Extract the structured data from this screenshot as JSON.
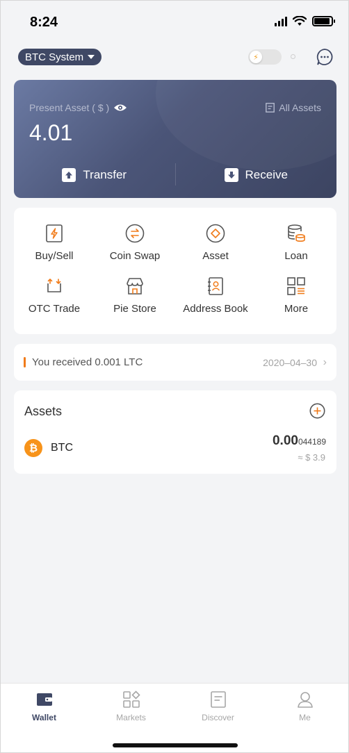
{
  "status_bar": {
    "time": "8:24",
    "battery_level": 0.9
  },
  "header": {
    "system_selector": "BTC System",
    "toggle_icon": "lightning-icon",
    "message_icon": "chat-bubble-icon"
  },
  "asset_card": {
    "label": "Present Asset ( $ )",
    "value": "4.01",
    "all_assets": "All Assets",
    "transfer": "Transfer",
    "receive": "Receive",
    "colors": {
      "gradient_start": "#6b7aa3",
      "gradient_end": "#3c4461"
    }
  },
  "menu": {
    "items": [
      {
        "label": "Buy/Sell",
        "icon": "lightning-bolt-icon"
      },
      {
        "label": "Coin Swap",
        "icon": "swap-arrows-icon"
      },
      {
        "label": "Asset",
        "icon": "diamond-icon"
      },
      {
        "label": "Loan",
        "icon": "coin-stack-icon"
      },
      {
        "label": "OTC Trade",
        "icon": "exchange-icon"
      },
      {
        "label": "Pie Store",
        "icon": "store-icon"
      },
      {
        "label": "Address Book",
        "icon": "contact-book-icon"
      },
      {
        "label": "More",
        "icon": "grid-icon"
      }
    ]
  },
  "notification": {
    "text": "You received 0.001  LTC",
    "date": "2020–04–30"
  },
  "assets": {
    "title": "Assets",
    "rows": [
      {
        "symbol": "BTC",
        "amount_main": "0.00",
        "amount_rest": "044189",
        "fiat": "≈ $ 3.9"
      }
    ]
  },
  "tab_bar": {
    "tabs": [
      {
        "label": "Wallet",
        "active": true
      },
      {
        "label": "Markets",
        "active": false
      },
      {
        "label": "Discover",
        "active": false
      },
      {
        "label": "Me",
        "active": false
      }
    ]
  },
  "colors": {
    "accent": "#f07b1a",
    "brand": "#3f4865",
    "background": "#f3f4f6"
  }
}
